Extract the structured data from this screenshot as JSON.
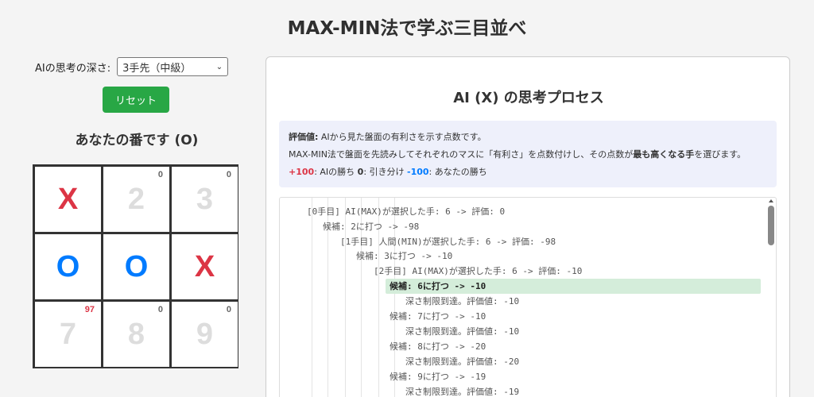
{
  "page_title": "MAX-MIN法で学ぶ三目並べ",
  "controls": {
    "depth_label": "AIの思考の深さ:",
    "depth_selected": "3手先（中級）",
    "reset_label": "リセット"
  },
  "turn_text": "あなたの番です (O)",
  "board": {
    "cells": [
      {
        "mark": "X",
        "score": ""
      },
      {
        "mark": "2",
        "score": "0"
      },
      {
        "mark": "3",
        "score": "0"
      },
      {
        "mark": "O",
        "score": ""
      },
      {
        "mark": "O",
        "score": ""
      },
      {
        "mark": "X",
        "score": ""
      },
      {
        "mark": "7",
        "score": "97"
      },
      {
        "mark": "8",
        "score": "0"
      },
      {
        "mark": "9",
        "score": "0"
      }
    ]
  },
  "panel": {
    "title": "AI (X) の思考プロセス",
    "info": {
      "eval_label": "評価値:",
      "eval_text": " AIから見た盤面の有利さを示す点数です。",
      "line2_a": "MAX-MIN法で盤面を先読みしてそれぞれのマスに「有利さ」を点数付けし、その点数が",
      "line2_bold": "最も高くなる手",
      "line2_b": "を選びます。",
      "plus100": "+100",
      "plus100_text": ": AIの勝ち ",
      "zero": "0",
      "zero_text": ": 引き分け ",
      "minus100": "-100",
      "minus100_text": ": あなたの勝ち"
    },
    "log": [
      "[0手目] AI(MAX)が選択した手: 6 -> 評価: 0",
      "候補: 2に打つ -> -98",
      "[1手目] 人間(MIN)が選択した手: 6 -> 評価: -98",
      "候補: 3に打つ -> -10",
      "[2手目] AI(MAX)が選択した手: 6 -> 評価: -10",
      "候補: 6に打つ -> -10",
      "深さ制限到達。評価値: -10",
      "候補: 7に打つ -> -10",
      "深さ制限到達。評価値: -10",
      "候補: 8に打つ -> -20",
      "深さ制限到達。評価値: -20",
      "候補: 9に打つ -> -19",
      "深さ制限到達。評価値: -19"
    ]
  },
  "colors": {
    "x_mark": "#dc3545",
    "o_mark": "#007bff",
    "reset_button": "#28a745",
    "highlight": "#d4edda",
    "info_bg": "#eef0fb"
  }
}
